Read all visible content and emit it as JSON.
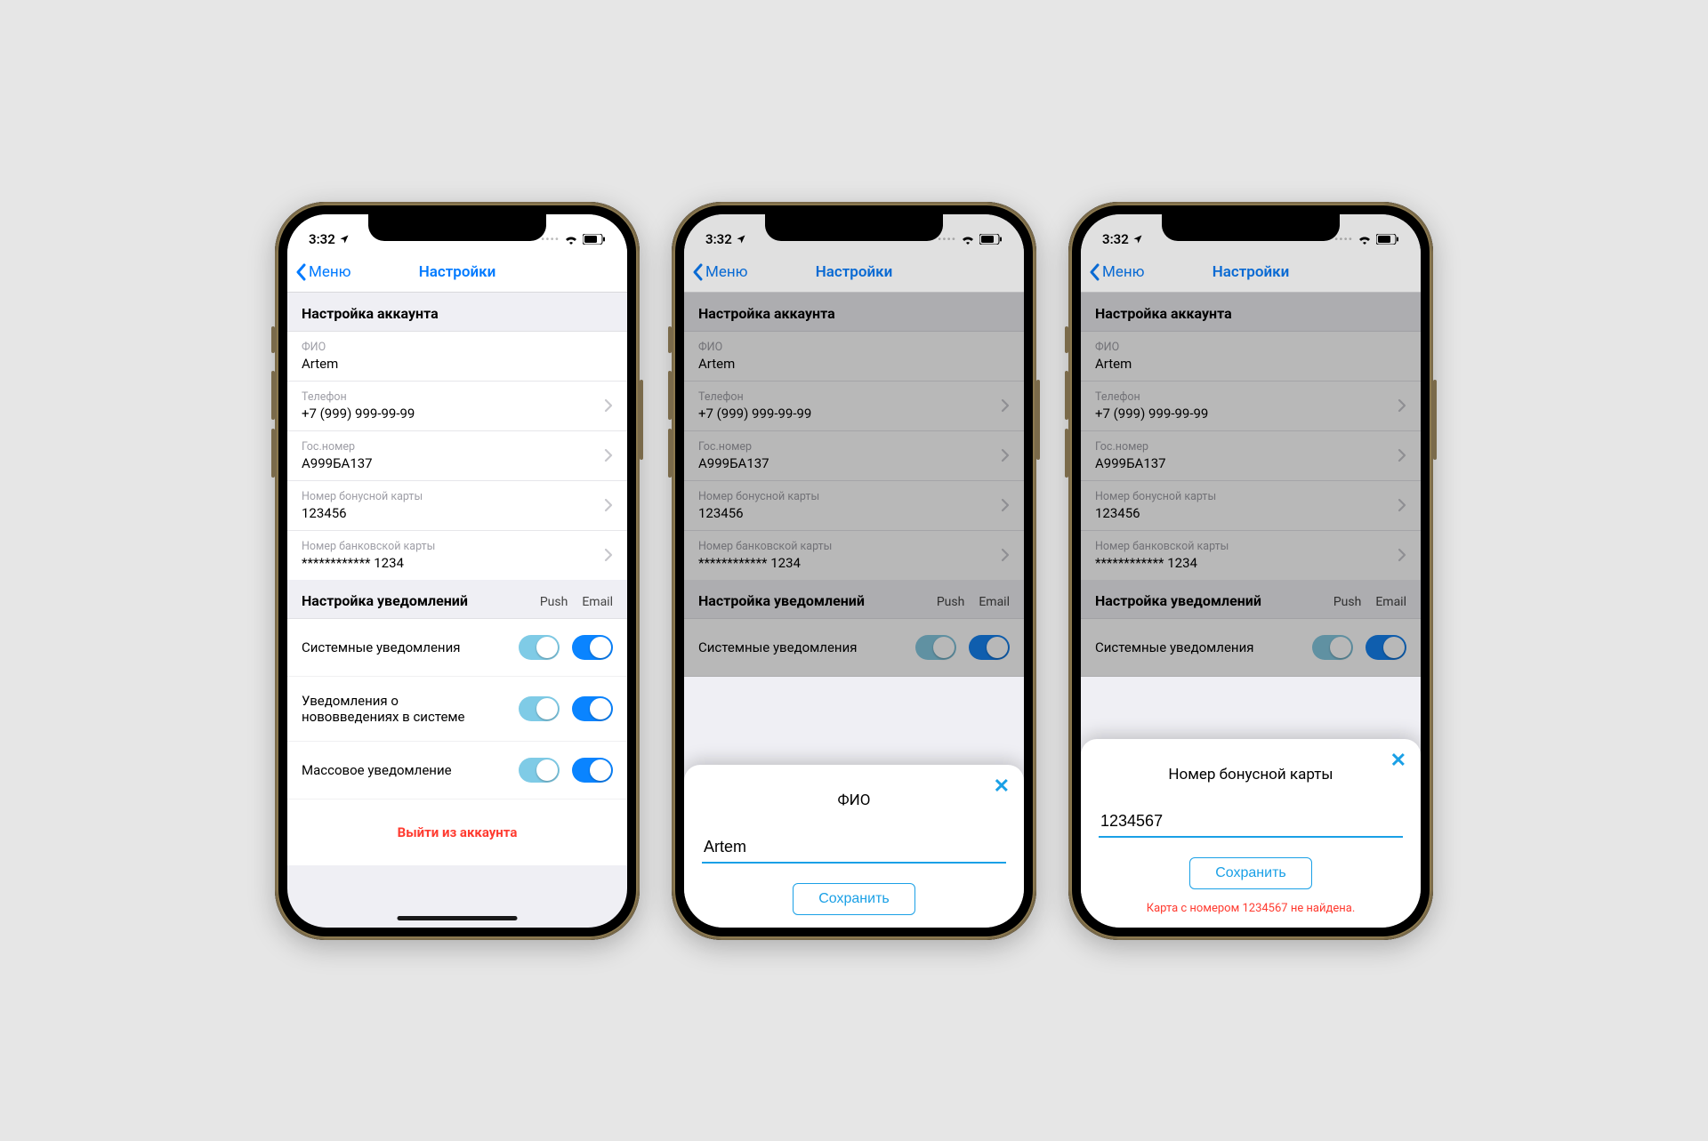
{
  "status": {
    "time": "3:32"
  },
  "nav": {
    "back": "Меню",
    "title": "Настройки"
  },
  "account": {
    "header": "Настройка аккаунта",
    "fields": {
      "fio": {
        "label": "ФИО",
        "value": "Artem"
      },
      "phone": {
        "label": "Телефон",
        "value": "+7 (999) 999-99-99"
      },
      "plate": {
        "label": "Гос.номер",
        "value": "А999БА137"
      },
      "bonus": {
        "label": "Номер бонусной карты",
        "value": "123456"
      },
      "bank": {
        "label": "Номер банковской карты",
        "value": "************ 1234"
      }
    }
  },
  "notifications": {
    "header": "Настройка уведомлений",
    "col_push": "Push",
    "col_email": "Email",
    "items": [
      {
        "title": "Системные уведомления"
      },
      {
        "title": "Уведомления о нововведениях в системе"
      },
      {
        "title": "Массовое уведомление"
      }
    ]
  },
  "logout": "Выйти из аккаунта",
  "sheet_fio": {
    "title": "ФИО",
    "value": "Artem",
    "save": "Сохранить"
  },
  "sheet_bonus": {
    "title": "Номер бонусной карты",
    "value": "1234567",
    "save": "Сохранить",
    "error": "Карта с номером 1234567 не найдена."
  }
}
